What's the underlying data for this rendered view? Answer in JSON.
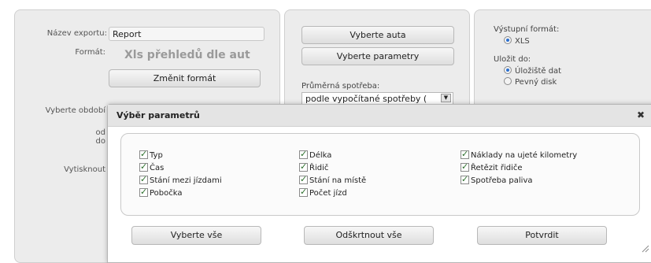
{
  "left_panel": {
    "export_name_label": "Název exportu:",
    "export_name_value": "Report",
    "format_label": "Formát:",
    "format_value": "Xls přehledů dle aut",
    "change_format_button": "Změnit formát",
    "period_label": "Vyberte období",
    "from_label": "od",
    "to_label": "do",
    "print_label": "Vytisknout"
  },
  "middle_panel": {
    "select_cars_button": "Vyberte auta",
    "select_params_button": "Vyberte parametry",
    "avg_consumption_label": "Průměrná spotřeba:",
    "avg_consumption_value": "podle vypočítané spotřeby ("
  },
  "right_panel": {
    "output_format_label": "Výstupní formát:",
    "output_format_option": "XLS",
    "save_to_label": "Uložit do:",
    "save_options": [
      "Úložiště dat",
      "Pevný disk"
    ]
  },
  "dialog": {
    "title": "Výběr parametrů",
    "close_label": "✖",
    "params": [
      {
        "label": "Typ",
        "checked": true
      },
      {
        "label": "Čas",
        "checked": true
      },
      {
        "label": "Stání mezi jízdami",
        "checked": true
      },
      {
        "label": "Pobočka",
        "checked": true
      },
      {
        "label": "Délka",
        "checked": true
      },
      {
        "label": "Řidič",
        "checked": true
      },
      {
        "label": "Stání na místě",
        "checked": true
      },
      {
        "label": "Počet jízd",
        "checked": true
      },
      {
        "label": "Náklady na ujeté kilometry",
        "checked": true
      },
      {
        "label": "Řetězit řidiče",
        "checked": true
      },
      {
        "label": "Spotřeba paliva",
        "checked": true
      }
    ],
    "select_all_button": "Vyberte vše",
    "uncheck_all_button": "Odškrtnout vše",
    "confirm_button": "Potvrdit"
  }
}
